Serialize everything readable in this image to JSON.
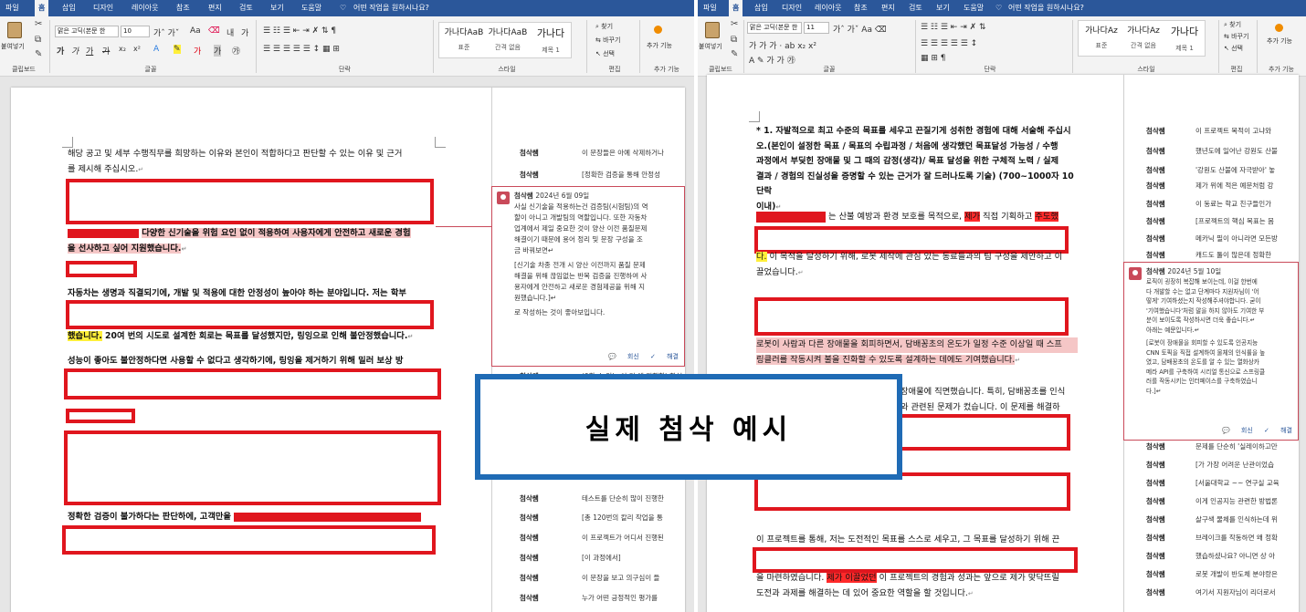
{
  "left": {
    "tabs": [
      "파일",
      "홈",
      "삽입",
      "디자인",
      "레이아웃",
      "참조",
      "편지",
      "검토",
      "보기",
      "도움말"
    ],
    "tell_me": "어떤 작업을 원하시나요?",
    "ribbon": {
      "paste": "붙여넣기",
      "font_name": "맑은 고딕(본문 한",
      "font_size": "10",
      "styles": [
        {
          "preview": "가나다AaB",
          "name": "표준"
        },
        {
          "preview": "가나다AaB",
          "name": "간격 없음"
        },
        {
          "preview": "가나다",
          "name": "제목 1"
        }
      ],
      "find": "찾기",
      "replace": "바꾸기",
      "select": "선택",
      "addins": "추가 기능",
      "groups": [
        "클립보드",
        "글꼴",
        "단락",
        "스타일",
        "편집",
        "추가 기능"
      ]
    },
    "doc": {
      "line1": "해당 공고 및 세부 수행직무를 희망하는 이유와 본인이 적합하다고 판단할 수 있는 이유 및 근거",
      "line2": "를 제시해 주십시오.",
      "p1a": "다양한 신기술을 위험 요인 없이 적용하여 사용자에게 안전하고 새로운 경험",
      "p1b": "을 선사하고 싶어 지원했습니다.",
      "p2": "자동차는 생명과 직결되기에, 개발 및 적용에 대한 안정성이 높아야 하는 분야입니다. 저는 학부",
      "p3_yellow": "했습니다.",
      "p3_rest": "20여 번의 시도로 설계한 회로는 목표를 달성했지만, 링잉으로 인해 불안정했습니다.",
      "p4": "성능이 좋아도 불안정하다면 사용할 수 없다고 생각하기에, 링잉을 제거하기 위해 밀러 보상 방",
      "p5": "정확한 검증이 불가하다는 판단하에, 고객만을"
    },
    "comments": [
      {
        "author": "첨삭쌤",
        "text": "이 문장들은 아예 삭제하거나"
      },
      {
        "author": "첨삭쌤",
        "text": "[정확한 검증을 통해 안정성"
      },
      {
        "author": "첨삭쌤",
        "text": "(0할 수 있는 이 기 에 진행한) 합처"
      },
      {
        "author": "첨삭쌤",
        "text": "테스트를 단순히 많이 진행한"
      },
      {
        "author": "첨삭쌤",
        "text": "[총 120번의 칼리 작업을 통"
      },
      {
        "author": "첨삭쌤",
        "text": "이 프로젝트가 어디서 진행된"
      },
      {
        "author": "첨삭쌤",
        "text": "[이 과정에서]"
      },
      {
        "author": "첨삭쌤",
        "text": "이 문장을 보고 의구심이 들"
      },
      {
        "author": "첨삭쌤",
        "text": "누가 어떤 긍정적인 평가를"
      }
    ],
    "card": {
      "author": "첨삭쌤",
      "date": "2024년 6월 09일",
      "lines": [
        "사실 신기술을 적용하는건 검증팀(시험팀)의 역",
        "할이 아니고 개발팀의 역할입니다. 또한 자동차",
        "업계에서 제일 중요한 것이 양산 이전 품질문제",
        "해결이기 때문에 용어 정리 및 문장 구성을 조",
        "금 바꿔보면↵",
        "",
        "[신기술 차종 전개 시 양산 이전까지 품질 문제",
        "해결을 위해 끊임없는 반복 검증을 진행하여 사",
        "용자에게 안전하고 새로운 경험제공을 위해 지",
        "원했습니다.]↵",
        "",
        "로 작성하는 것이 좋아보입니다."
      ],
      "reply": "회신",
      "resolve": "해결"
    }
  },
  "right": {
    "tabs": [
      "파일",
      "홈",
      "삽입",
      "디자인",
      "레이아웃",
      "참조",
      "편지",
      "검토",
      "보기",
      "도움말"
    ],
    "tell_me": "어떤 작업을 원하시나요?",
    "ribbon": {
      "paste": "붙여넣기",
      "font_name": "맑은 고딕(본문 한",
      "font_size": "11",
      "styles": [
        {
          "preview": "가나다Az",
          "name": "표준"
        },
        {
          "preview": "가나다Az",
          "name": "간격 없음"
        },
        {
          "preview": "가나다",
          "name": "제목 1"
        }
      ],
      "find": "찾기",
      "replace": "바꾸기",
      "select": "선택",
      "addins": "추가 기능",
      "groups": [
        "클립보드",
        "글꼴",
        "단락",
        "스타일",
        "편집",
        "추가 기능"
      ]
    },
    "doc": {
      "q1": "* 1. 자발적으로 최고 수준의 목표를 세우고 끈질기게 성취한 경험에 대해 서술해 주십시",
      "q2": "오.(본인이 설정한 목표 / 목표의 수립과정 / 처음에 생각했던 목표달성 가능성 / 수행",
      "q3": "과정에서 부딪힌 장애물 및 그 때의 감정(생각)/ 목표 달성을 위한 구체적 노력 / 실제",
      "q4": "결과 / 경험의 진실성을 증명할 수 있는 근거가 잘 드러나도록 기술) (700~1000자 10단락",
      "q5": "이내)",
      "a1_pre": "는 산불 예방과 환경 보호를 목적으로,",
      "a1_red": "제가",
      "a1_mid": "직접 기획하고",
      "a1_yellow": "주도했",
      "a2_yellow": "다.",
      "a2_rest": "이 목적을 달성하기 위해, 로봇 제작에 관심 있는 동료들과의 팀 구성을 제안하고 이",
      "a3": "끌었습니다.",
      "a4": "로봇이 사람과 다른 장애물을 회피하면서, 담배꽁초의 온도가 일정 수준 이상일 때 스프",
      "a5": "링클러를 작동시켜 불을 진화할 수 있도록 설계하는 데에도 기여했습니다.",
      "a6": "장애물에 직면했습니다. 특히, 담배꽁초를 인식",
      "a7": "와 관련된 문제가 컸습니다. 이 문제를 해결하",
      "a8": "이 프로젝트를 통해, 저는 도전적인 목표를 스스로 세우고, 그 목표를 달성하기 위해 끈",
      "a9_pre": "을 마련하였습니다.",
      "a9_red": "제가 이끌었던",
      "a9_rest": "이 프로젝트의 경험과 성과는 앞으로 제가 맞닥뜨릴",
      "a10": "도전과 과제를 해결하는 데 있어 중요한 역할을 할 것입니다."
    },
    "comments_top": [
      {
        "author": "첨삭쌤",
        "text": "이 프로젝트 목적이 고냐와"
      },
      {
        "author": "첨삭쌤",
        "text": "했년도에 일어난 강원도 산불"
      },
      {
        "author": "첨삭쌤",
        "text": "'강원도 산불에 자극받아' 놓"
      },
      {
        "author": "첨삭쌤",
        "text": "제가 위에 적은 예문처럼 강"
      },
      {
        "author": "첨삭쌤",
        "text": "이 동료는 학교 친구들인가"
      },
      {
        "author": "첨삭쌤",
        "text": "[프로젝트의 핵심 목표는 몸"
      },
      {
        "author": "첨삭쌤",
        "text": "메카닉 필이 아니라면 모든방"
      },
      {
        "author": "첨삭쌤",
        "text": "캐드도 툴이 많은데 정확한"
      }
    ],
    "comments_bottom": [
      {
        "author": "첨삭쌤",
        "text": "문제를 단순히 '실레이하고만"
      },
      {
        "author": "첨삭쌤",
        "text": "[가 가장 어려운 난관이었습"
      },
      {
        "author": "첨삭쌤",
        "text": "[서울대학교 ~~ 연구실 교육"
      },
      {
        "author": "첨삭쌤",
        "text": "이게 인공지능 관련한 방법론"
      },
      {
        "author": "첨삭쌤",
        "text": "살구색 물체를 인식하는데 위"
      },
      {
        "author": "첨삭쌤",
        "text": "브레이크를 작동하면 왜 정확"
      },
      {
        "author": "첨삭쌤",
        "text": "했습하셨나요? 아니면 상 아"
      },
      {
        "author": "첨삭쌤",
        "text": "로봇 개발이 반도체 분야랑은"
      },
      {
        "author": "첨삭쌤",
        "text": "여기서 지원자님이 리더로서"
      }
    ],
    "card": {
      "author": "첨삭쌤",
      "date": "2024년 5월 10일",
      "lines": [
        "로직이 굉장히 복잡해 보이는데, 이걸 한번에",
        "다 개발할 수는 없고 단계마다 지원자님이 '어",
        "떻게' 기여하셨는지 작성해주셔야합니다. 굳이",
        "'기여했습니다'처럼 말을 하지 않아도 기여한 부",
        "분이 보이도록 작성하시면 더욱 좋습니다.↵",
        "아래는 예문입니다.↵",
        "",
        "[로봇이 장애물을 회피할 수 있도록 인공지능",
        "CNN 토픽을 직접 설계하여 물체의 인식률을 높",
        "였고, 담배꽁초의 온도를 알 수 있는 열화상카",
        "메라 API를 구축하여 시리얼 통신으로 스프링클",
        "러를 작동시키는 인터페이스를 구축하였습니",
        "다.]↵"
      ],
      "reply": "회신",
      "resolve": "해결"
    }
  },
  "overlay_text": "실제 첨삭 예시",
  "colors": {
    "ribbon_blue": "#2b579a",
    "markup_red": "#e0161e",
    "overlay_border": "#1f6bb5",
    "highlight_yellow": "#ffef3a",
    "comment_accent": "#c94a5a"
  }
}
